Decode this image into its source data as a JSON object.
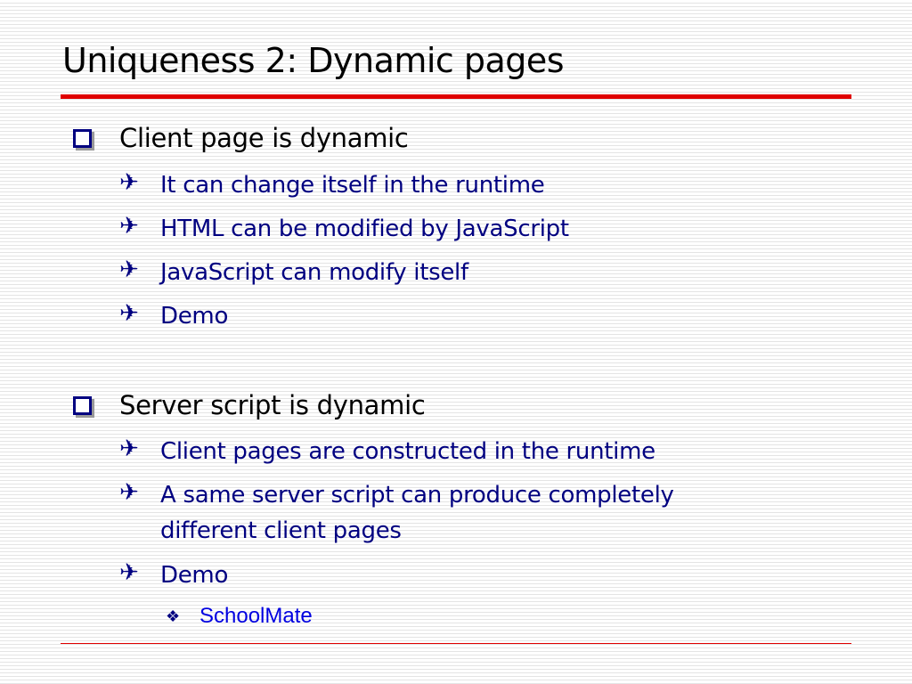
{
  "slide": {
    "title": "Uniqueness 2: Dynamic pages",
    "colors": {
      "accent_red": "#e00000",
      "sub_text": "#000080",
      "level3_text": "#0000e0",
      "bullet_box": "#000080"
    },
    "sections": [
      {
        "heading": "Client page is dynamic",
        "bullets": [
          "It can change itself in the runtime",
          "HTML can be modified by JavaScript",
          "JavaScript can modify itself",
          "Demo"
        ]
      },
      {
        "heading": "Server script is dynamic",
        "bullets": [
          "Client pages are constructed in the runtime",
          "A same server script can produce completely",
          "different client pages",
          "Demo"
        ],
        "subbullets": [
          "SchoolMate"
        ]
      }
    ],
    "icons": {
      "level1": "square-bullet-icon",
      "level2": "airplane-bullet-icon",
      "level3": "diamond-bullet-icon"
    }
  }
}
